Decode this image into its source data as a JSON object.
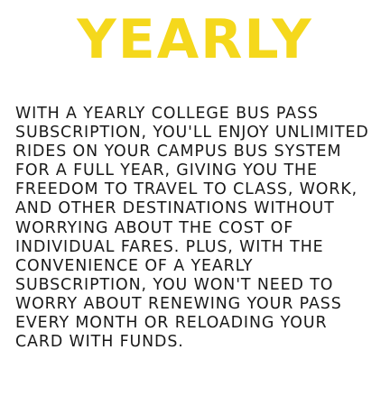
{
  "headline": "YEARLY",
  "body_lines": [
    "WITH A YEARLY COLLEGE BUS PASS",
    "SUBSCRIPTION, YOU'LL ENJOY UNLIMITED",
    "RIDES ON YOUR CAMPUS BUS SYSTEM",
    "FOR A FULL YEAR, GIVING YOU THE",
    "FREEDOM TO TRAVEL TO CLASS, WORK,",
    "AND OTHER DESTINATIONS WITHOUT",
    "WORRYING ABOUT THE COST OF",
    "INDIVIDUAL FARES. PLUS, WITH THE",
    "CONVENIENCE OF A YEARLY",
    "SUBSCRIPTION, YOU WON'T NEED TO",
    "WORRY ABOUT RENEWING YOUR PASS",
    "EVERY MONTH OR RELOADING YOUR",
    "CARD WITH FUNDS."
  ],
  "colors": {
    "headline": "#f5d81c",
    "body_text": "#1a1a1a",
    "background": "#ffffff"
  }
}
